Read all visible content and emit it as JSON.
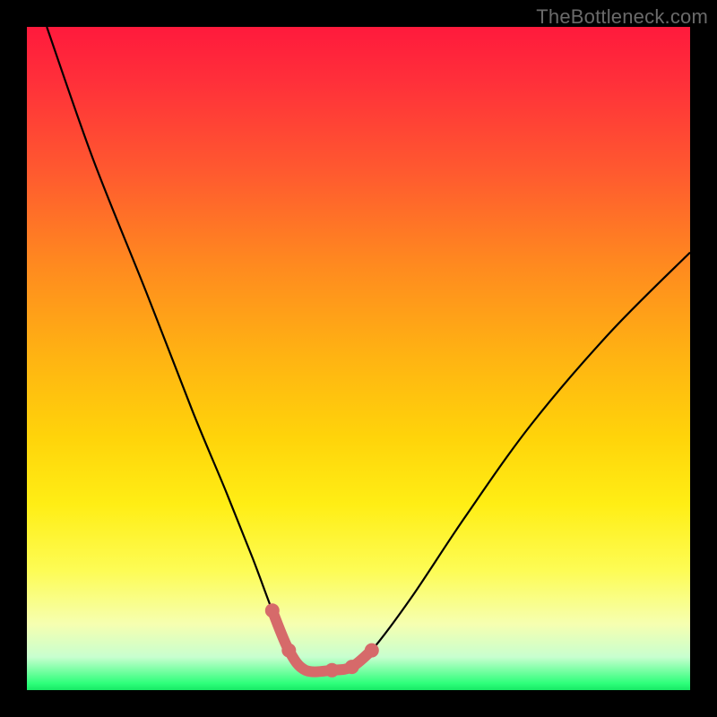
{
  "watermark": "TheBottleneck.com",
  "chart_data": {
    "type": "line",
    "title": "",
    "xlabel": "",
    "ylabel": "",
    "xlim": [
      0,
      100
    ],
    "ylim": [
      0,
      100
    ],
    "series": [
      {
        "name": "black-curve",
        "x": [
          3,
          10,
          18,
          25,
          30,
          34,
          37,
          39.5,
          42,
          46,
          49,
          52,
          58,
          66,
          76,
          88,
          100
        ],
        "values": [
          100,
          80,
          60,
          42,
          30,
          20,
          12,
          6,
          3,
          3,
          3.5,
          6,
          14,
          26,
          40,
          54,
          66
        ]
      },
      {
        "name": "highlight-segment",
        "x": [
          37,
          39.5,
          42,
          46,
          49,
          52
        ],
        "values": [
          12,
          6,
          3,
          3,
          3.5,
          6
        ]
      }
    ],
    "highlight_points": {
      "x": [
        37,
        39.5,
        46,
        49,
        52
      ],
      "values": [
        12,
        6,
        3,
        3.5,
        6
      ]
    },
    "colors": {
      "curve": "#000000",
      "highlight": "#d66a6a",
      "gradient_top": "#ff1a3c",
      "gradient_mid": "#ffd40a",
      "gradient_bottom": "#18e865"
    }
  }
}
